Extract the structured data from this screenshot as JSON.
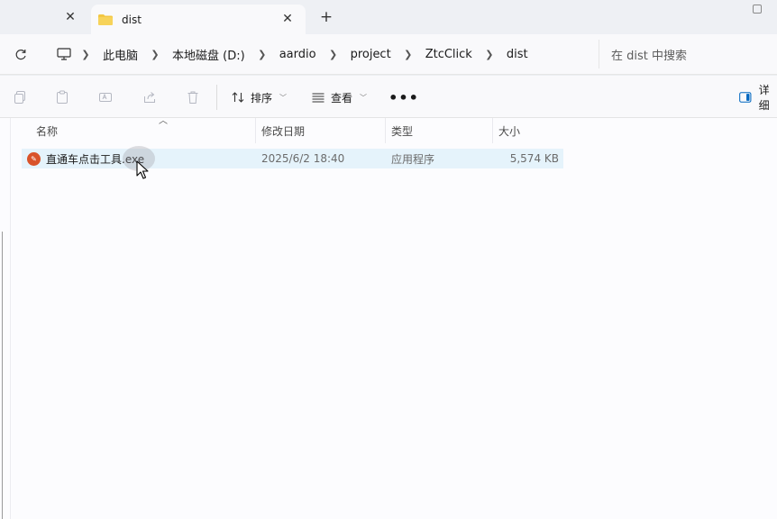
{
  "titlebar": {
    "active_tab_title": "dist",
    "close_glyph": "✕",
    "new_tab_glyph": "+",
    "folder_color": "#f3c742"
  },
  "address": {
    "crumbs": [
      "此电脑",
      "本地磁盘 (D:)",
      "aardio",
      "project",
      "ZtcClick",
      "dist"
    ],
    "search_placeholder": "在 dist 中搜索"
  },
  "commandbar": {
    "sort_label": "排序",
    "view_label": "查看",
    "more_label": "•••",
    "details_label": "详细"
  },
  "columns": {
    "name": "名称",
    "modified": "修改日期",
    "type": "类型",
    "size": "大小"
  },
  "files": [
    {
      "name": "直通车点击工具.exe",
      "modified": "2025/6/2 18:40",
      "type": "应用程序",
      "size": "5,574 KB",
      "icon": "exe-app-icon",
      "icon_color": "#d9532a"
    }
  ],
  "colors": {
    "selection": "#e5f3fb",
    "accent": "#0067c0"
  }
}
